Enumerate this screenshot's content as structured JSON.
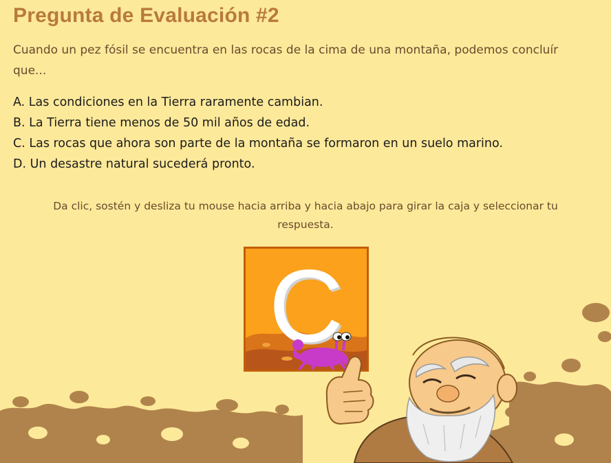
{
  "quiz": {
    "title": "Pregunta de Evaluación #2",
    "question": "Cuando un pez fósil se encuentra en las rocas de la cima de una montaña, podemos concluír que...",
    "answers": [
      "A. Las condiciones en la Tierra raramente cambian.",
      "B. La Tierra tiene menos de 50 mil años de edad.",
      "C. Las rocas que ahora son parte de la montaña se formaron en un suelo marino.",
      "D. Un desastre natural sucederá pronto."
    ],
    "instruction": "Da clic, sostén y desliza tu mouse hacia arriba y hacia abajo para girar la caja y seleccionar tu respuesta.",
    "selected_letter": "C"
  },
  "colors": {
    "background": "#fde99a",
    "title": "#b87a3c",
    "box_fill": "#fba11b",
    "box_border": "#c25e08",
    "dirt": "#b0834c",
    "crab": "#c83bc8"
  },
  "icons": {
    "crab": "crab-icon",
    "dirt": "dirt-decoration",
    "mascot": "old-man-mascot"
  }
}
